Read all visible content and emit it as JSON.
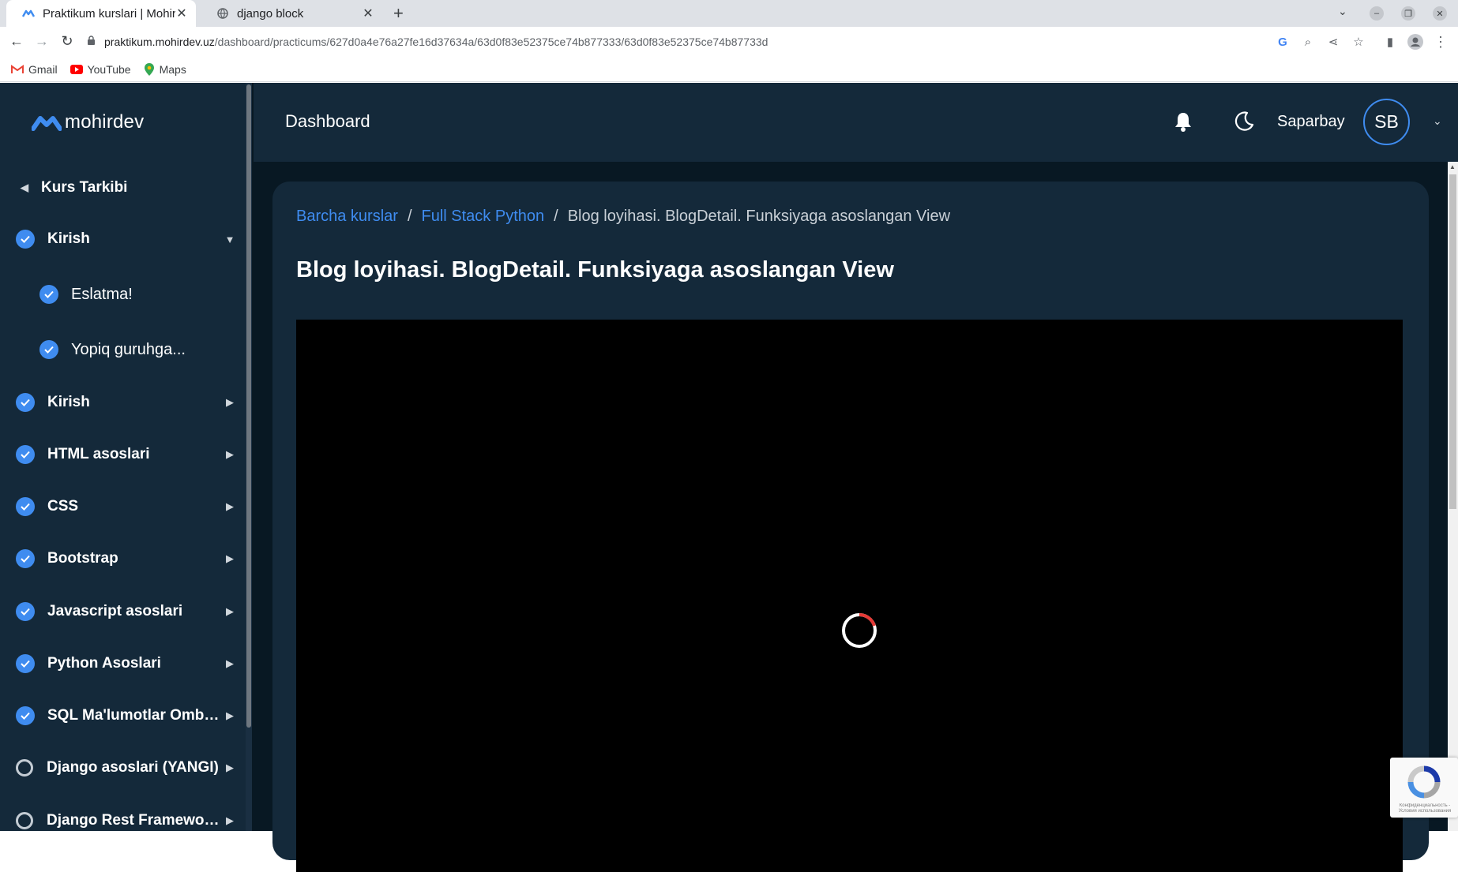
{
  "browser": {
    "tabs": [
      {
        "title": "Praktikum kurslari | Mohirdev",
        "active": true
      },
      {
        "title": "django block",
        "active": false
      }
    ],
    "url_host": "praktikum.mohirdev.uz",
    "url_path": "/dashboard/practicums/627d0a4e76a27fe16d37634a/63d0f83e52375ce74b877333/63d0f83e52375ce74b87733d",
    "bookmarks": [
      {
        "label": "Gmail",
        "icon": "gmail-icon"
      },
      {
        "label": "YouTube",
        "icon": "youtube-icon"
      },
      {
        "label": "Maps",
        "icon": "maps-icon"
      }
    ]
  },
  "sidebar": {
    "logo_text": "mohirdev",
    "back_label": "Kurs Tarkibi",
    "items": [
      {
        "label": "Kirish",
        "status": "done",
        "expanded": true
      },
      {
        "label": "Eslatma!",
        "status": "done",
        "sub": true
      },
      {
        "label": "Yopiq guruhga...",
        "status": "done",
        "sub": true
      },
      {
        "label": "Kirish",
        "status": "done"
      },
      {
        "label": "HTML asoslari",
        "status": "done"
      },
      {
        "label": "CSS",
        "status": "done"
      },
      {
        "label": "Bootstrap",
        "status": "done"
      },
      {
        "label": "Javascript asoslari",
        "status": "done"
      },
      {
        "label": "Python Asoslari",
        "status": "done"
      },
      {
        "label": "SQL Ma'lumotlar Ombori...",
        "status": "done"
      },
      {
        "label": "Django asoslari (YANGI)",
        "status": "pending"
      },
      {
        "label": "Django Rest Framework...",
        "status": "pending"
      }
    ]
  },
  "header": {
    "title": "Dashboard",
    "username": "Saparbay",
    "avatar_initials": "SB"
  },
  "breadcrumb": {
    "items": [
      "Barcha kurslar",
      "Full Stack Python"
    ],
    "current": "Blog loyihasi. BlogDetail. Funksiyaga asoslangan View"
  },
  "lesson": {
    "title": "Blog loyihasi. BlogDetail. Funksiyaga asoslangan View"
  },
  "recaptcha": {
    "text": "Конфиденциальность - Условия использования"
  },
  "colors": {
    "accent": "#3f8cf0",
    "sidebar_bg": "#14293a",
    "page_bg": "#081823",
    "spinner": "#e53935"
  }
}
